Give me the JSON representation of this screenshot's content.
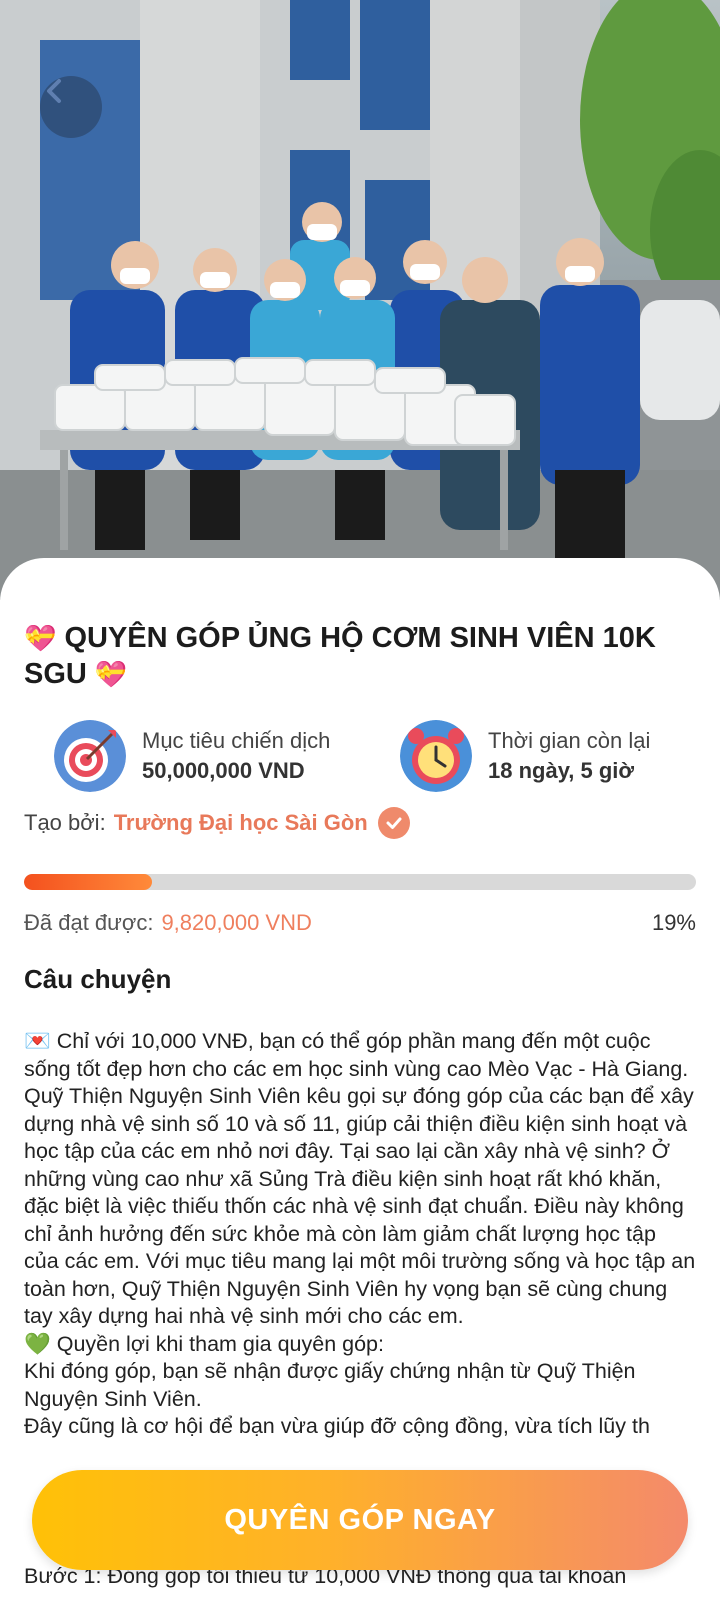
{
  "hero": {
    "image_description_icon": "volunteers-photo",
    "back_icon": "chevron-left-icon"
  },
  "campaign": {
    "title": "QUYÊN GÓP ỦNG HỘ CƠM SINH VIÊN 10K SGU",
    "title_emoji": "💝"
  },
  "target": {
    "icon": "target-icon",
    "label": "Mục tiêu chiến dịch",
    "value": "50,000,000 VND"
  },
  "remaining": {
    "icon": "alarm-clock-icon",
    "label": "Thời gian còn lại",
    "value": "18 ngày, 5 giờ"
  },
  "creator": {
    "prefix": "Tạo bởi:",
    "name": "Trường Đại học Sài Gòn",
    "verified_icon": "check-badge-icon"
  },
  "progress": {
    "fraction": 0.19,
    "achieved_label": "Đã đạt được:",
    "achieved_amount": "9,820,000 VND",
    "percent_text": "19%"
  },
  "story": {
    "heading": "Câu chuyện",
    "p1": "💌 Chỉ với 10,000 VNĐ, bạn có thể góp phần mang đến một cuộc sống tốt đẹp hơn cho các em học sinh vùng cao Mèo Vạc - Hà Giang. Quỹ Thiện Nguyện Sinh Viên kêu gọi sự đóng góp của các bạn để xây dựng nhà vệ sinh số 10 và số 11, giúp cải thiện điều kiện sinh hoạt và học tập của các em nhỏ nơi đây. Tại sao lại cần xây nhà vệ sinh? Ở những vùng cao như xã Sủng Trà điều kiện sinh hoạt rất khó khăn, đặc biệt là việc thiếu thốn các nhà vệ sinh đạt chuẩn. Điều này không chỉ ảnh hưởng đến sức khỏe mà còn làm giảm chất lượng học tập của các em. Với mục tiêu mang lại một môi trường sống và học tập an toàn hơn, Quỹ Thiện Nguyện Sinh Viên hy vọng bạn sẽ cùng chung tay xây dựng hai nhà vệ sinh mới cho các em.",
    "p2": "💚 Quyền lợi khi tham gia quyên góp:",
    "p3": "Khi đóng góp, bạn sẽ nhận được giấy chứng nhận từ Quỹ Thiện Nguyện Sinh Viên.",
    "p4": "Đây cũng là cơ hội để bạn vừa giúp đỡ cộng đồng, vừa tích lũy th",
    "p5": "Bước 1: Đóng góp tối thiểu từ 10,000 VNĐ thông qua tài khoản"
  },
  "cta": {
    "label": "QUYÊN GÓP NGAY"
  },
  "colors": {
    "accent": "#ef7f5e",
    "progress": "#f4511e",
    "button_start": "#ffc107",
    "button_end": "#f48a6b"
  }
}
